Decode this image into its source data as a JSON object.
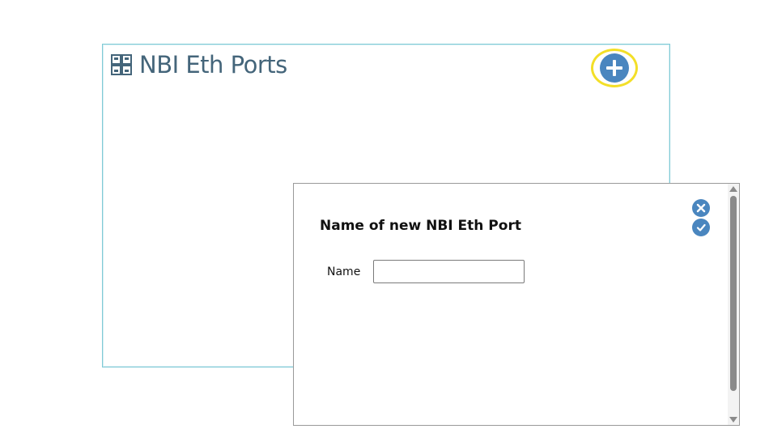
{
  "panel": {
    "title": "NBI Eth Ports",
    "icon": "grid-icon",
    "add_icon": "plus-circle-icon",
    "highlight_color": "#f3df28",
    "accent_color": "#4a86bf"
  },
  "dialog": {
    "title": "Name of new NBI Eth Port",
    "name_label": "Name",
    "name_value": "",
    "cancel_icon": "close-icon",
    "confirm_icon": "check-icon"
  }
}
